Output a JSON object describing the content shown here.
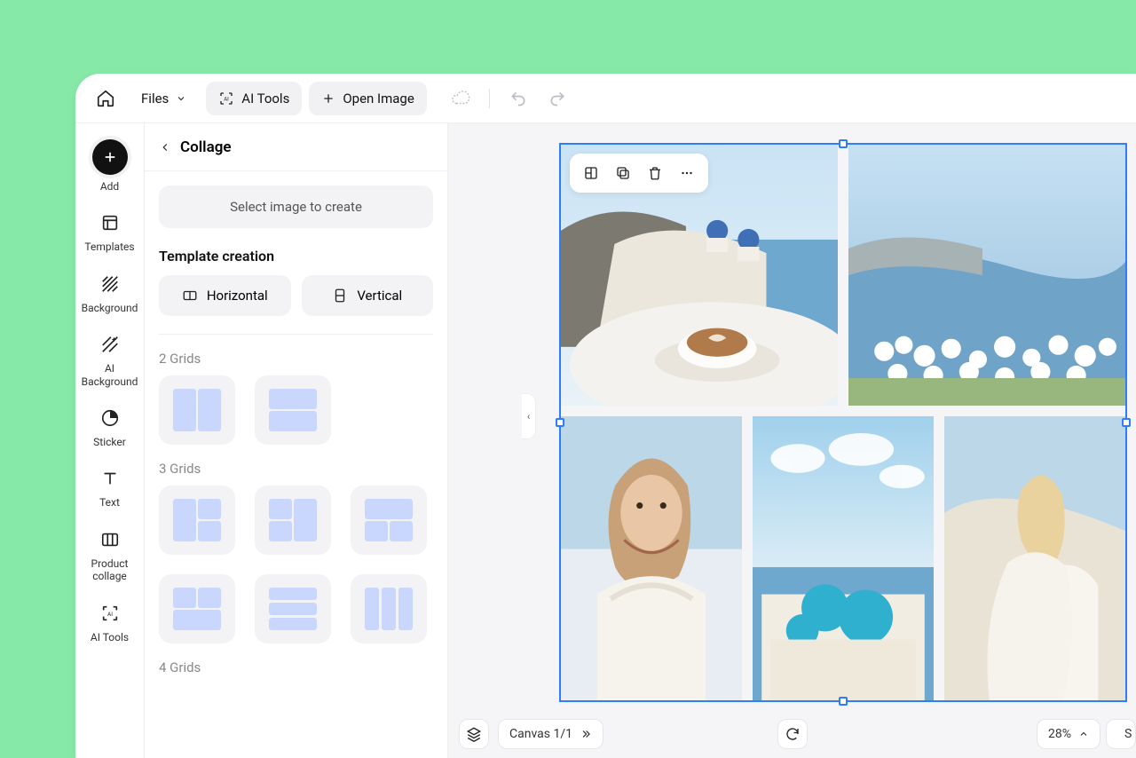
{
  "toolbar": {
    "files_label": "Files",
    "ai_tools_label": "AI Tools",
    "open_image_label": "Open Image"
  },
  "rail": {
    "add": "Add",
    "templates": "Templates",
    "background": "Background",
    "ai_background": "AI Background",
    "sticker": "Sticker",
    "text": "Text",
    "product_collage": "Product collage",
    "ai_tools": "AI Tools"
  },
  "panel": {
    "title": "Collage",
    "select_create": "Select image to create",
    "template_creation": "Template creation",
    "horizontal": "Horizontal",
    "vertical": "Vertical",
    "grids2": "2 Grids",
    "grids3": "3 Grids",
    "grids4": "4 Grids"
  },
  "canvas": {
    "canvas_label": "Canvas 1/1",
    "zoom_label": "28%"
  }
}
